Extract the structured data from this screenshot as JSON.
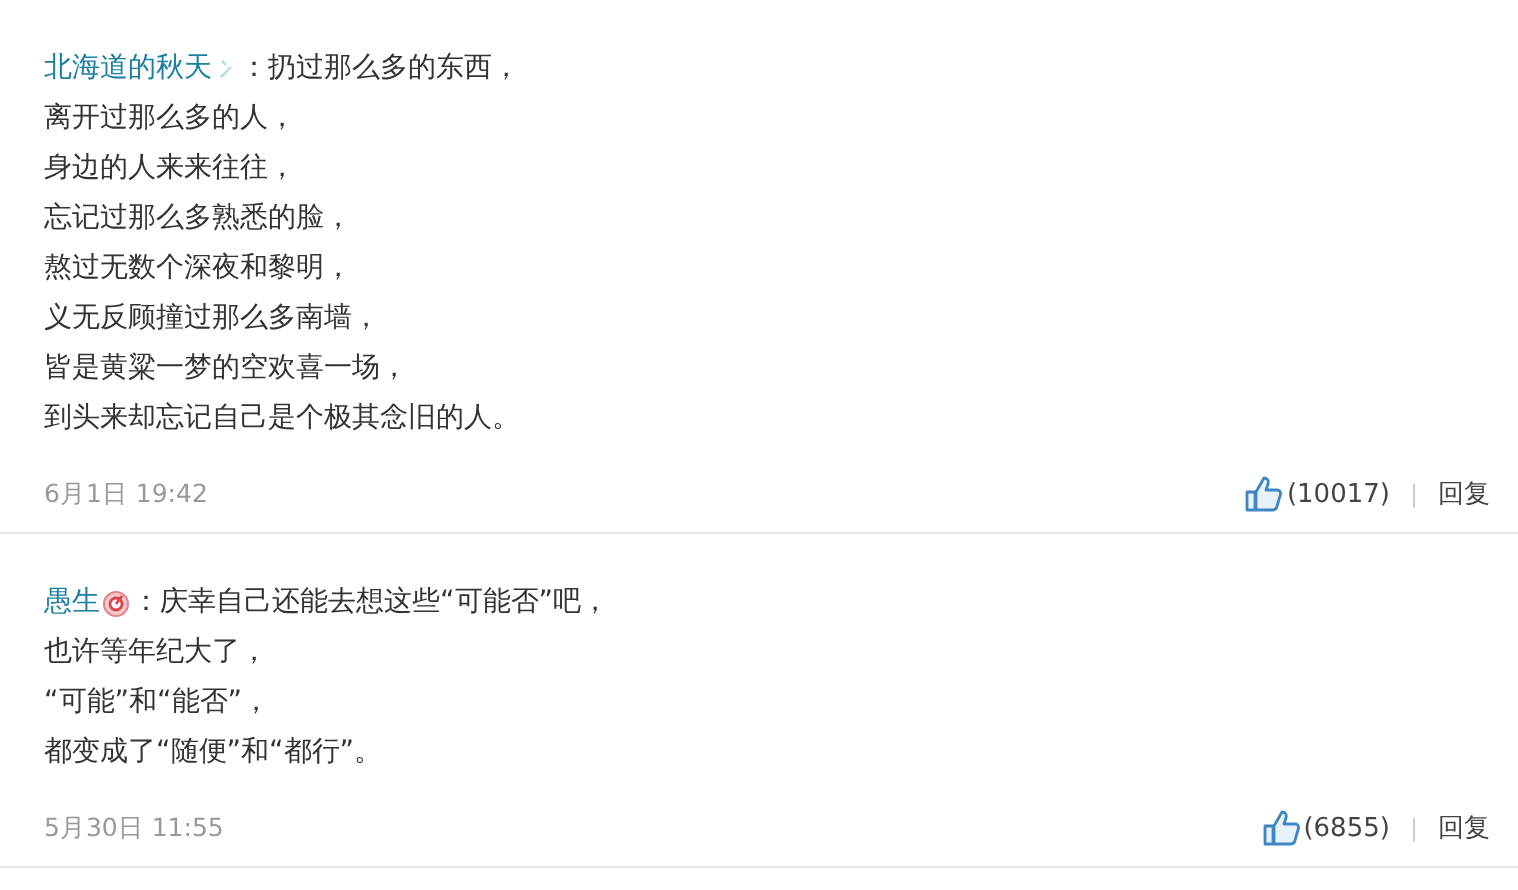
{
  "comments": [
    {
      "author": "北海道的秋天",
      "badge": {
        "kind": "broken"
      },
      "lines": [
        "：扔过那么多的东西，",
        "离开过那么多的人，",
        "身边的人来来往往，",
        "忘记过那么多熟悉的脸，",
        "熬过无数个深夜和黎明，",
        "义无反顾撞过那么多南墙，",
        "皆是黄粱一梦的空欢喜一场，",
        "到头来却忘记自己是个极其念旧的人。"
      ],
      "time": "6月1日 19:42",
      "likes": "(10017)",
      "separator": "|",
      "reply": "回复"
    },
    {
      "author": "愚生",
      "badge": {
        "kind": "medal"
      },
      "lines": [
        "：庆幸自己还能去想这些“可能否”吧，",
        "也许等年纪大了，",
        "“可能”和“能否”，",
        "都变成了“随便”和“都行”。"
      ],
      "time": "5月30日 11:55",
      "likes": "(6855)",
      "separator": "|",
      "reply": "回复"
    }
  ]
}
